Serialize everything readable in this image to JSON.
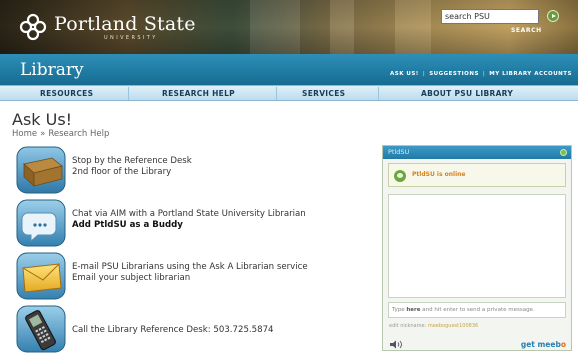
{
  "header": {
    "university_name": "Portland State",
    "university_sub": "UNIVERSITY",
    "search": {
      "value": "search PSU",
      "label": "SEARCH"
    }
  },
  "library_bar": {
    "title": "Library",
    "links": [
      "ASK US!",
      "SUGGESTIONS",
      "MY LIBRARY ACCOUNTS"
    ],
    "separator": "|"
  },
  "nav": {
    "items": [
      "RESOURCES",
      "RESEARCH HELP",
      "SERVICES",
      "ABOUT PSU LIBRARY"
    ]
  },
  "page": {
    "title": "Ask Us!",
    "breadcrumb": [
      "Home",
      "Research Help"
    ],
    "breadcrumb_separator": "»"
  },
  "options": [
    {
      "icon": "reference-desk-icon",
      "line1": "Stop by the Reference Desk",
      "line2": "2nd floor of the Library",
      "bold": ""
    },
    {
      "icon": "chat-bubble-icon",
      "line1": "Chat via AIM with a Portland State University Librarian",
      "line2": "",
      "bold": "Add PtldSU as a Buddy"
    },
    {
      "icon": "email-envelope-icon",
      "line1": "E-mail PSU Librarians using the Ask A Librarian service",
      "line2": "Email your subject librarian",
      "bold": ""
    },
    {
      "icon": "phone-icon",
      "line1": "Call the Library Reference Desk: 503.725.5874",
      "line2": "",
      "bold": ""
    }
  ],
  "chat": {
    "title": "PtldSU",
    "status": "PtldSU is online",
    "input_placeholder_prefix": "Type ",
    "input_placeholder_bold": "here",
    "input_placeholder_suffix": " and hit enter to send a private message.",
    "nick_prefix": "edit nickname: ",
    "nick_value": "meeboguest100836",
    "brand_get": "get ",
    "brand_name": "meeb",
    "brand_o": "o"
  },
  "colors": {
    "library_bar": "#1f7aa2",
    "nav_bg": "#cfe6f4",
    "status_orange": "#d87f1a",
    "meebo_blue": "#2b7fb0",
    "meebo_orange": "#e86b13"
  }
}
